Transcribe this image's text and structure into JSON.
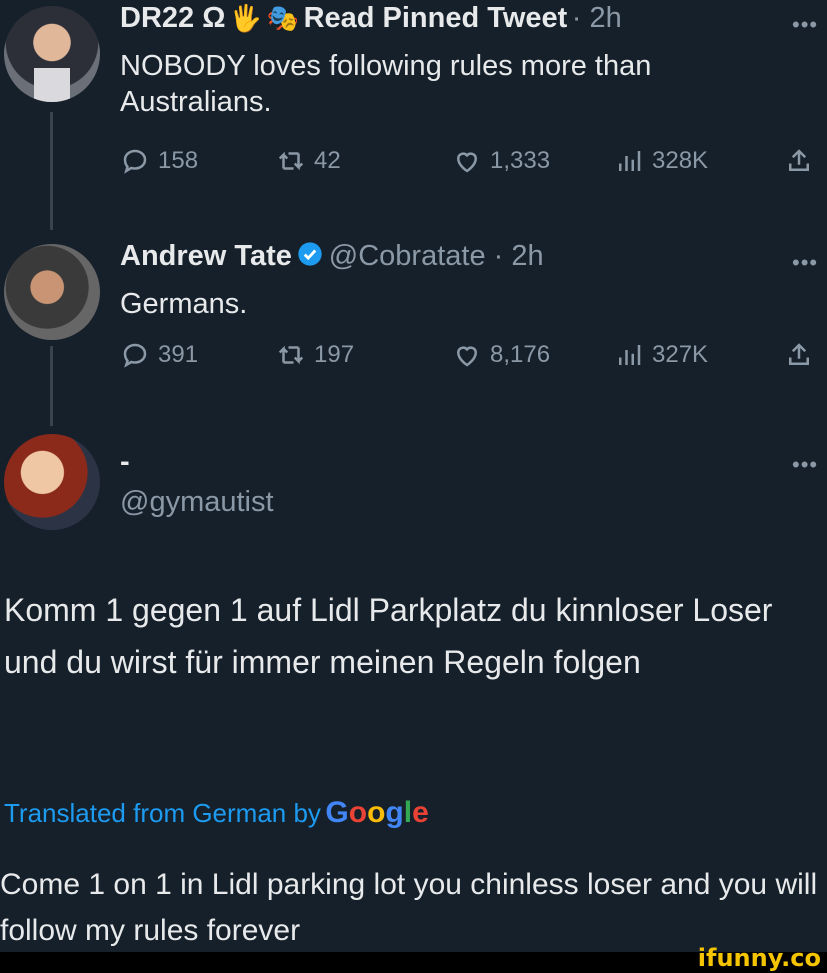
{
  "tweets": [
    {
      "name": "DR22 Ω",
      "extra": "Read Pinned Tweet",
      "meta": "· 2h",
      "text": "NOBODY loves following rules more than Australians.",
      "stats": {
        "replies": "158",
        "retweets": "42",
        "likes": "1,333",
        "views": "328K"
      }
    },
    {
      "name": "Andrew Tate",
      "handle": "@Cobratate · 2h",
      "text": "Germans.",
      "stats": {
        "replies": "391",
        "retweets": "197",
        "likes": "8,176",
        "views": "327K"
      }
    },
    {
      "name": "-",
      "handle": "@gymautist",
      "text": "Komm 1 gegen 1 auf Lidl Parkplatz du kinnloser Loser und du wirst für immer meinen Regeln folgen",
      "translated_prefix": "Translated from German by",
      "translated_by": "Google",
      "translation": "Come 1 on 1 in Lidl parking lot you chinless loser and you will follow my rules forever"
    }
  ],
  "more_glyph": "•••",
  "watermark": "ifunny.co"
}
